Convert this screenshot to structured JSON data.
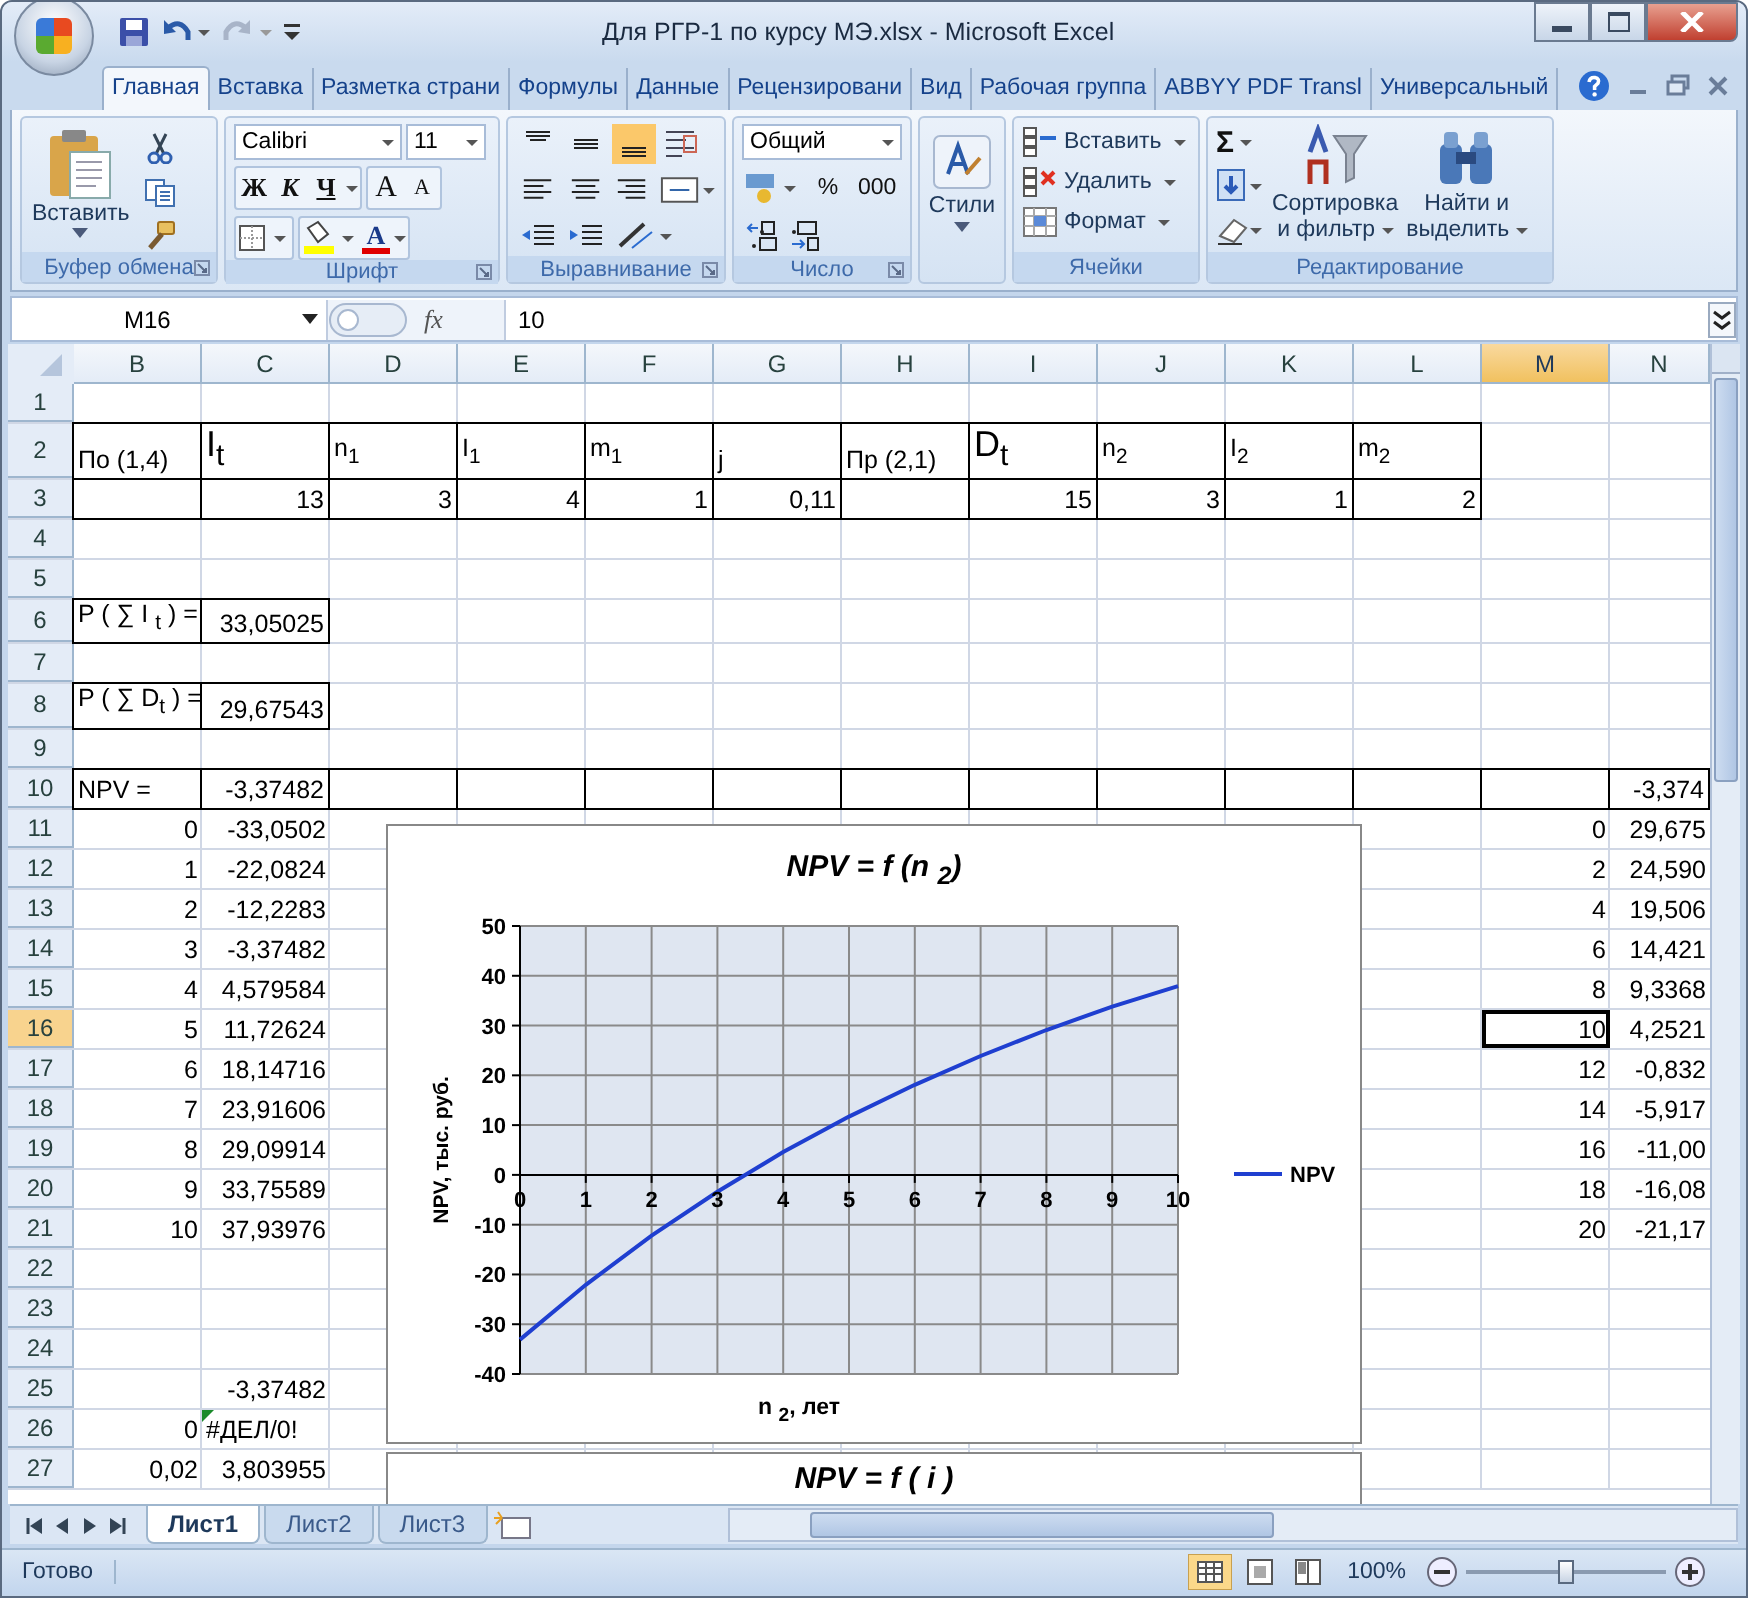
{
  "window": {
    "title": "Для РГР-1 по курсу МЭ.xlsx - Microsoft Excel"
  },
  "ribbon_tabs": [
    {
      "label": "Главная",
      "selected": true
    },
    {
      "label": "Вставка",
      "selected": false
    },
    {
      "label": "Разметка страни",
      "selected": false
    },
    {
      "label": "Формулы",
      "selected": false
    },
    {
      "label": "Данные",
      "selected": false
    },
    {
      "label": "Рецензировани",
      "selected": false
    },
    {
      "label": "Вид",
      "selected": false
    },
    {
      "label": "Рабочая группа",
      "selected": false
    },
    {
      "label": "ABBYY PDF Transl",
      "selected": false
    },
    {
      "label": "Универсальный",
      "selected": false
    }
  ],
  "ribbon": {
    "clipboard": {
      "paste": "Вставить",
      "label": "Буфер обмена"
    },
    "font": {
      "family": "Calibri",
      "size": "11",
      "bold": "Ж",
      "italic": "К",
      "underline": "Ч",
      "grow": "A",
      "shrink": "A",
      "font_color_button": "A",
      "label": "Шрифт"
    },
    "alignment": {
      "label": "Выравнивание"
    },
    "number": {
      "format": "Общий",
      "percent": "%",
      "thousands": "000",
      "label": "Число"
    },
    "styles": {
      "label": "Стили"
    },
    "cells": {
      "insert": "Вставить",
      "delete": "Удалить",
      "format": "Формат",
      "label": "Ячейки"
    },
    "editing": {
      "sum": "Σ",
      "sort": [
        "Сортировка",
        "и фильтр"
      ],
      "find": [
        "Найти и",
        "выделить"
      ],
      "label": "Редактирование"
    }
  },
  "formula_bar": {
    "name_box": "M16",
    "fx": "fx",
    "value": "10"
  },
  "columns": [
    {
      "label": "B",
      "selected": false
    },
    {
      "label": "C",
      "selected": false
    },
    {
      "label": "D",
      "selected": false
    },
    {
      "label": "E",
      "selected": false
    },
    {
      "label": "F",
      "selected": false
    },
    {
      "label": "G",
      "selected": false
    },
    {
      "label": "H",
      "selected": false
    },
    {
      "label": "I",
      "selected": false
    },
    {
      "label": "J",
      "selected": false
    },
    {
      "label": "K",
      "selected": false
    },
    {
      "label": "L",
      "selected": false
    },
    {
      "label": "M",
      "selected": true
    },
    {
      "label": "N",
      "selected": false
    }
  ],
  "rows": [
    {
      "n": "1",
      "selected": false
    },
    {
      "n": "2",
      "selected": false,
      "boxed": true,
      "cells": [
        {
          "v": "По (1,4)",
          "num": false
        },
        {
          "v": "I$_{t}$",
          "num": false,
          "big": true
        },
        {
          "v": "n$_{1}$",
          "num": false
        },
        {
          "v": "I$_{1}$",
          "num": false
        },
        {
          "v": "m$_{1}$",
          "num": false
        },
        {
          "v": "j",
          "num": false
        },
        {
          "v": "Пр (2,1)",
          "num": false
        },
        {
          "v": "D$_{t}$",
          "num": false,
          "big": true
        },
        {
          "v": "n$_{2}$",
          "num": false
        },
        {
          "v": "I$_{2}$",
          "num": false
        },
        {
          "v": "m$_{2}$",
          "num": false
        }
      ]
    },
    {
      "n": "3",
      "selected": false,
      "boxed": true,
      "cells": [
        null,
        {
          "v": "13",
          "num": true
        },
        {
          "v": "3",
          "num": true
        },
        {
          "v": "4",
          "num": true
        },
        {
          "v": "1",
          "num": true
        },
        {
          "v": "0,11",
          "num": true
        },
        null,
        {
          "v": "15",
          "num": true
        },
        {
          "v": "3",
          "num": true
        },
        {
          "v": "1",
          "num": true
        },
        {
          "v": "2",
          "num": true
        }
      ]
    },
    {
      "n": "4",
      "selected": false
    },
    {
      "n": "5",
      "selected": false
    },
    {
      "n": "6",
      "selected": false,
      "boxed": true,
      "cells": [
        {
          "v": "P ( ∑ I $_{t}$ ) =",
          "num": false
        },
        {
          "v": "33,05025",
          "num": true
        }
      ]
    },
    {
      "n": "7",
      "selected": false
    },
    {
      "n": "8",
      "selected": false,
      "boxed": true,
      "cells": [
        {
          "v": "P ( ∑ D$_{t}$ ) =",
          "num": false
        },
        {
          "v": "29,67543",
          "num": true
        }
      ]
    },
    {
      "n": "9",
      "selected": false
    },
    {
      "n": "10",
      "selected": false,
      "boxed": true,
      "cells": [
        {
          "v": "NPV =",
          "num": false
        },
        {
          "v": "-3,37482",
          "num": true
        },
        null,
        null,
        null,
        null,
        null,
        null,
        null,
        null,
        null,
        null,
        {
          "v": "-3,374",
          "num": true
        }
      ]
    },
    {
      "n": "11",
      "selected": false,
      "cells": [
        {
          "v": "0",
          "num": true
        },
        {
          "v": "-33,0502",
          "num": true
        },
        null,
        null,
        null,
        null,
        null,
        null,
        null,
        null,
        null,
        {
          "v": "0",
          "num": true
        },
        {
          "v": "29,675",
          "num": true
        }
      ]
    },
    {
      "n": "12",
      "selected": false,
      "cells": [
        {
          "v": "1",
          "num": true
        },
        {
          "v": "-22,0824",
          "num": true
        },
        null,
        null,
        null,
        null,
        null,
        null,
        null,
        null,
        null,
        {
          "v": "2",
          "num": true
        },
        {
          "v": "24,590",
          "num": true
        }
      ]
    },
    {
      "n": "13",
      "selected": false,
      "cells": [
        {
          "v": "2",
          "num": true
        },
        {
          "v": "-12,2283",
          "num": true
        },
        null,
        null,
        null,
        null,
        null,
        null,
        null,
        null,
        null,
        {
          "v": "4",
          "num": true
        },
        {
          "v": "19,506",
          "num": true
        }
      ]
    },
    {
      "n": "14",
      "selected": false,
      "cells": [
        {
          "v": "3",
          "num": true
        },
        {
          "v": "-3,37482",
          "num": true
        },
        null,
        null,
        null,
        null,
        null,
        null,
        null,
        null,
        null,
        {
          "v": "6",
          "num": true
        },
        {
          "v": "14,421",
          "num": true
        }
      ]
    },
    {
      "n": "15",
      "selected": false,
      "cells": [
        {
          "v": "4",
          "num": true
        },
        {
          "v": "4,579584",
          "num": true
        },
        null,
        null,
        null,
        null,
        null,
        null,
        null,
        null,
        null,
        {
          "v": "8",
          "num": true
        },
        {
          "v": "9,3368",
          "num": true
        }
      ]
    },
    {
      "n": "16",
      "selected": true,
      "cells": [
        {
          "v": "5",
          "num": true
        },
        {
          "v": "11,72624",
          "num": true
        },
        null,
        null,
        null,
        null,
        null,
        null,
        null,
        null,
        null,
        {
          "v": "10",
          "num": true
        },
        {
          "v": "4,2521",
          "num": true
        }
      ]
    },
    {
      "n": "17",
      "selected": false,
      "cells": [
        {
          "v": "6",
          "num": true
        },
        {
          "v": "18,14716",
          "num": true
        },
        null,
        null,
        null,
        null,
        null,
        null,
        null,
        null,
        null,
        {
          "v": "12",
          "num": true
        },
        {
          "v": "-0,832",
          "num": true
        }
      ]
    },
    {
      "n": "18",
      "selected": false,
      "cells": [
        {
          "v": "7",
          "num": true
        },
        {
          "v": "23,91606",
          "num": true
        },
        null,
        null,
        null,
        null,
        null,
        null,
        null,
        null,
        null,
        {
          "v": "14",
          "num": true
        },
        {
          "v": "-5,917",
          "num": true
        }
      ]
    },
    {
      "n": "19",
      "selected": false,
      "cells": [
        {
          "v": "8",
          "num": true
        },
        {
          "v": "29,09914",
          "num": true
        },
        null,
        null,
        null,
        null,
        null,
        null,
        null,
        null,
        null,
        {
          "v": "16",
          "num": true
        },
        {
          "v": "-11,00",
          "num": true
        }
      ]
    },
    {
      "n": "20",
      "selected": false,
      "cells": [
        {
          "v": "9",
          "num": true
        },
        {
          "v": "33,75589",
          "num": true
        },
        null,
        null,
        null,
        null,
        null,
        null,
        null,
        null,
        null,
        {
          "v": "18",
          "num": true
        },
        {
          "v": "-16,08",
          "num": true
        }
      ]
    },
    {
      "n": "21",
      "selected": false,
      "cells": [
        {
          "v": "10",
          "num": true
        },
        {
          "v": "37,93976",
          "num": true
        },
        null,
        null,
        null,
        null,
        null,
        null,
        null,
        null,
        null,
        {
          "v": "20",
          "num": true
        },
        {
          "v": "-21,17",
          "num": true
        }
      ]
    },
    {
      "n": "22",
      "selected": false
    },
    {
      "n": "23",
      "selected": false
    },
    {
      "n": "24",
      "selected": false
    },
    {
      "n": "25",
      "selected": false,
      "cells": [
        null,
        {
          "v": "-3,37482",
          "num": true
        }
      ]
    },
    {
      "n": "26",
      "selected": false,
      "cells": [
        {
          "v": "0",
          "num": true
        },
        {
          "v": "#ДЕЛ/0!",
          "num": false,
          "error_flag": true
        }
      ]
    },
    {
      "n": "27",
      "selected": false,
      "cells": [
        {
          "v": "0,02",
          "num": true
        },
        {
          "v": "3,803955",
          "num": true
        }
      ]
    }
  ],
  "chart": {
    "chart_data": {
      "type": "line",
      "title": "NPV = f (n $_{2}$)",
      "xlabel": "n $_{2}$, лет",
      "ylabel": "NPV, тыс. руб.",
      "x": [
        0,
        1,
        2,
        3,
        4,
        5,
        6,
        7,
        8,
        9,
        10
      ],
      "series": [
        {
          "name": "NPV",
          "color": "#1f3fd0",
          "values": [
            -33.1,
            -22.1,
            -12.2,
            -3.4,
            4.6,
            11.7,
            18.1,
            23.9,
            29.1,
            33.8,
            37.9
          ]
        }
      ],
      "grid": true,
      "xlim": [
        0,
        10
      ],
      "ylim": [
        -40,
        50
      ],
      "xticks": [
        0,
        1,
        2,
        3,
        4,
        5,
        6,
        7,
        8,
        9,
        10
      ],
      "yticks": [
        -40,
        -30,
        -20,
        -10,
        0,
        10,
        20,
        30,
        40,
        50
      ]
    }
  },
  "chart2": {
    "title": "NPV = f ( i )"
  },
  "sheet_tabs": [
    {
      "label": "Лист1",
      "selected": true
    },
    {
      "label": "Лист2",
      "selected": false
    },
    {
      "label": "Лист3",
      "selected": false
    }
  ],
  "status_bar": {
    "text": "Готово",
    "zoom": "100%",
    "zoom_slider": {
      "level": 0.5
    }
  }
}
